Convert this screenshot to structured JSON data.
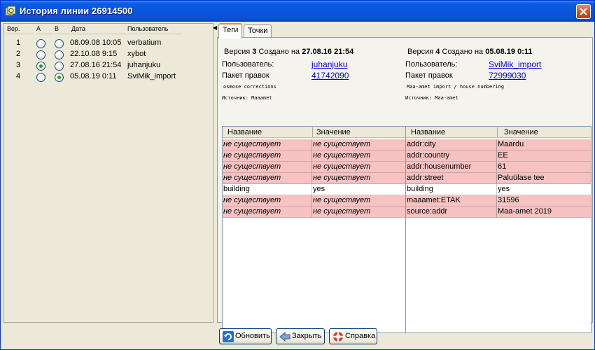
{
  "window": {
    "title": "История линии 26914500"
  },
  "versions_table": {
    "headers": {
      "ver": "Вер.",
      "a": "A",
      "b": "B",
      "date": "Дата",
      "user": "Пользователь"
    },
    "rows": [
      {
        "ver": "1",
        "date": "08.09.08 10:05",
        "user": "verbatium",
        "a": false,
        "b": false
      },
      {
        "ver": "2",
        "date": "22.10.08 9:15",
        "user": "xybot",
        "a": false,
        "b": false
      },
      {
        "ver": "3",
        "date": "27.08.16 21:54",
        "user": "juhanjuku",
        "a": true,
        "b": false
      },
      {
        "ver": "4",
        "date": "05.08.19 0:11",
        "user": "SviMik_import",
        "a": false,
        "b": true
      }
    ]
  },
  "tabs": [
    {
      "label": "Теги"
    },
    {
      "label": "Точки"
    }
  ],
  "left_version": {
    "prefix": "Версия",
    "number": "3",
    "created_label": "Создано на",
    "created": "27.08.16 21:54",
    "user_label": "Пользователь:",
    "user": "juhanjuku",
    "changeset_label": "Пакет правок",
    "changeset": "41742090",
    "comment": "osmose corrections",
    "source": "Источник: Maaamet"
  },
  "right_version": {
    "prefix": "Версия",
    "number": "4",
    "created_label": "Создано на",
    "created": "05.08.19 0:11",
    "user_label": "Пользователь:",
    "user": "SviMik_import",
    "changeset_label": "Пакет правок",
    "changeset": "72999030",
    "comment": "Maa-amet import / house numbering",
    "source": "Источник: Maa-amet"
  },
  "tag_headers": {
    "name": "Название",
    "value": "Значение"
  },
  "left_tags": [
    {
      "key": "не существует",
      "value": "не существует",
      "missing": true
    },
    {
      "key": "не существует",
      "value": "не существует",
      "missing": true
    },
    {
      "key": "не существует",
      "value": "не существует",
      "missing": true
    },
    {
      "key": "не существует",
      "value": "не существует",
      "missing": true
    },
    {
      "key": "building",
      "value": "yes",
      "missing": false,
      "same": true
    },
    {
      "key": "не существует",
      "value": "не существует",
      "missing": true
    },
    {
      "key": "не существует",
      "value": "не существует",
      "missing": true
    }
  ],
  "right_tags": [
    {
      "key": "addr:city",
      "value": "Maardu"
    },
    {
      "key": "addr:country",
      "value": "EE"
    },
    {
      "key": "addr:housenumber",
      "value": "61"
    },
    {
      "key": "addr:street",
      "value": "Paluülase tee"
    },
    {
      "key": "building",
      "value": "yes",
      "same": true
    },
    {
      "key": "maaamet:ETAK",
      "value": "31596"
    },
    {
      "key": "source:addr",
      "value": "Maa-amet 2019"
    }
  ],
  "buttons": {
    "refresh": "Обновить",
    "close": "Закрыть",
    "help": "Справка"
  },
  "colors": {
    "diff_row": "#f7c2c2",
    "link": "#0000ee",
    "titlebar": "#0855dd"
  }
}
